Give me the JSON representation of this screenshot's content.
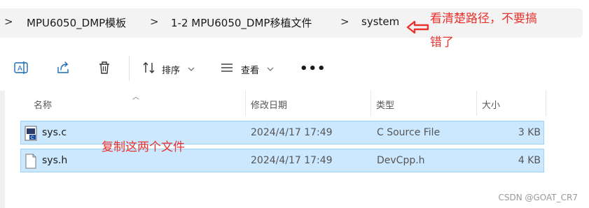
{
  "breadcrumb": {
    "items": [
      "MPU6050_DMP模板",
      "1-2 MPU6050_DMP移植文件",
      "system"
    ],
    "separator": ">"
  },
  "annotations": {
    "path_note_line1": "看清楚路径，不要搞",
    "path_note_line2": "错了",
    "copy_note": "复制这两个文件",
    "color": "#e8322d"
  },
  "toolbar": {
    "rename_icon": "rename-icon",
    "share_icon": "share-icon",
    "delete_icon": "trash-icon",
    "sort_label": "排序",
    "view_label": "查看",
    "more_label": "•••"
  },
  "columns": {
    "name": "名称",
    "date": "修改日期",
    "type": "类型",
    "size": "大小"
  },
  "files": [
    {
      "name": "sys.c",
      "date": "2024/4/17 17:49",
      "type": "C Source File",
      "size": "3 KB",
      "icon": "c-source-file-icon"
    },
    {
      "name": "sys.h",
      "date": "2024/4/17 17:49",
      "type": "DevCpp.h",
      "size": "4 KB",
      "icon": "text-file-icon"
    }
  ],
  "watermark": "CSDN @GOAT_CR7",
  "colors": {
    "selection_bg": "#cce8ff",
    "selection_border": "#99d1ff",
    "address_bg": "#f3f3f3"
  }
}
